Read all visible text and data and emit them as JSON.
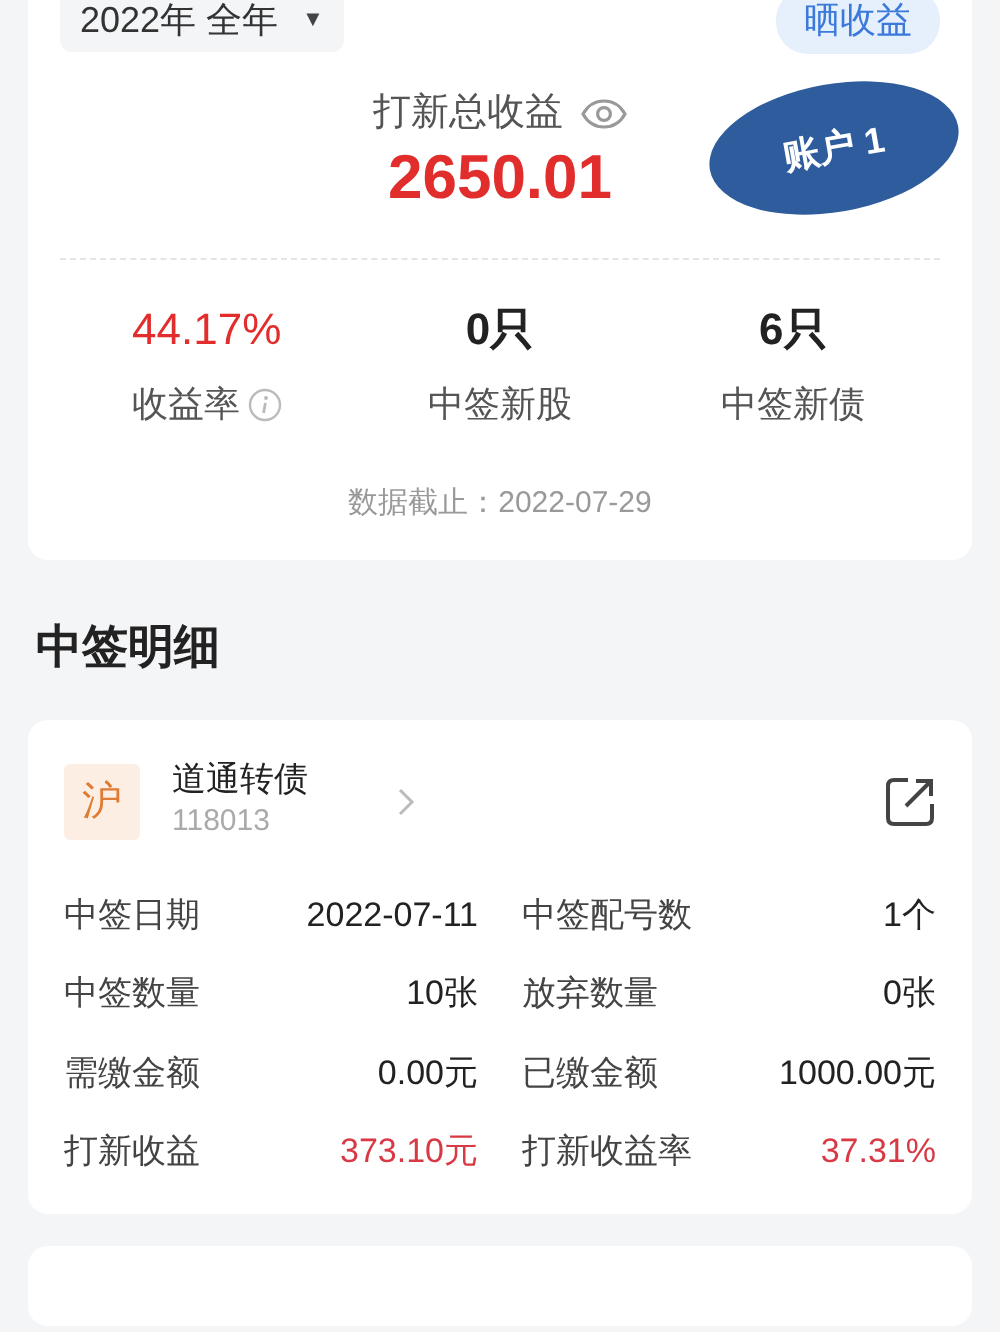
{
  "period_selector": {
    "label": "2022年 全年",
    "caret": "▼"
  },
  "share_button": "晒收益",
  "summary": {
    "title": "打新总收益",
    "amount": "2650.01",
    "account_tag": "账户 1"
  },
  "stats": [
    {
      "value": "44.17%",
      "label": "收益率",
      "info": true,
      "kind": "profit"
    },
    {
      "value": "0只",
      "label": "中签新股",
      "info": false,
      "kind": "plain"
    },
    {
      "value": "6只",
      "label": "中签新债",
      "info": false,
      "kind": "plain"
    }
  ],
  "data_date": "数据截止：2022-07-29",
  "section_title": "中签明细",
  "records": [
    {
      "market": "沪",
      "name": "道通转债",
      "code": "118013",
      "fields": [
        {
          "label": "中签日期",
          "value": "2022-07-11",
          "kind": "plain"
        },
        {
          "label": "中签配号数",
          "value": "1个",
          "kind": "plain"
        },
        {
          "label": "中签数量",
          "value": "10张",
          "kind": "plain"
        },
        {
          "label": "放弃数量",
          "value": "0张",
          "kind": "plain"
        },
        {
          "label": "需缴金额",
          "value": "0.00元",
          "kind": "plain"
        },
        {
          "label": "已缴金额",
          "value": "1000.00元",
          "kind": "plain"
        },
        {
          "label": "打新收益",
          "value": "373.10元",
          "kind": "profit"
        },
        {
          "label": "打新收益率",
          "value": "37.31%",
          "kind": "profit"
        }
      ]
    }
  ]
}
